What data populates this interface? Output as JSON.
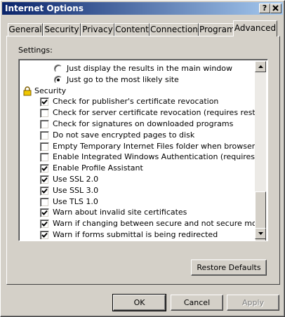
{
  "window": {
    "title": "Internet Options"
  },
  "title_buttons": {
    "help": "?",
    "close": "X"
  },
  "tabs": [
    {
      "label": "General",
      "active": false
    },
    {
      "label": "Security",
      "active": false
    },
    {
      "label": "Privacy",
      "active": false
    },
    {
      "label": "Content",
      "active": false
    },
    {
      "label": "Connections",
      "active": false
    },
    {
      "label": "Programs",
      "active": false
    },
    {
      "label": "Advanced",
      "active": true
    }
  ],
  "settings": {
    "label": "Settings:",
    "rows": [
      {
        "type": "radio",
        "label": "Just display the results in the main window",
        "checked": false
      },
      {
        "type": "radio",
        "label": "Just go to the most likely site",
        "checked": true
      },
      {
        "type": "category",
        "label": "Security",
        "icon": "lock-icon"
      },
      {
        "type": "checkbox",
        "label": "Check for publisher's certificate revocation",
        "checked": true
      },
      {
        "type": "checkbox",
        "label": "Check for server certificate revocation (requires restart)",
        "checked": false
      },
      {
        "type": "checkbox",
        "label": "Check for signatures on downloaded programs",
        "checked": false
      },
      {
        "type": "checkbox",
        "label": "Do not save encrypted pages to disk",
        "checked": false
      },
      {
        "type": "checkbox",
        "label": "Empty Temporary Internet Files folder when browser is closed",
        "checked": false
      },
      {
        "type": "checkbox",
        "label": "Enable Integrated Windows Authentication (requires restart)",
        "checked": false
      },
      {
        "type": "checkbox",
        "label": "Enable Profile Assistant",
        "checked": true
      },
      {
        "type": "checkbox",
        "label": "Use SSL 2.0",
        "checked": true
      },
      {
        "type": "checkbox",
        "label": "Use SSL 3.0",
        "checked": true
      },
      {
        "type": "checkbox",
        "label": "Use TLS 1.0",
        "checked": false
      },
      {
        "type": "checkbox",
        "label": "Warn about invalid site certificates",
        "checked": true
      },
      {
        "type": "checkbox",
        "label": "Warn if changing between secure and not secure mode",
        "checked": true
      },
      {
        "type": "checkbox",
        "label": "Warn if forms submittal is being redirected",
        "checked": true
      }
    ]
  },
  "buttons": {
    "restore_defaults": "Restore Defaults",
    "ok": "OK",
    "cancel": "Cancel",
    "apply": "Apply"
  }
}
